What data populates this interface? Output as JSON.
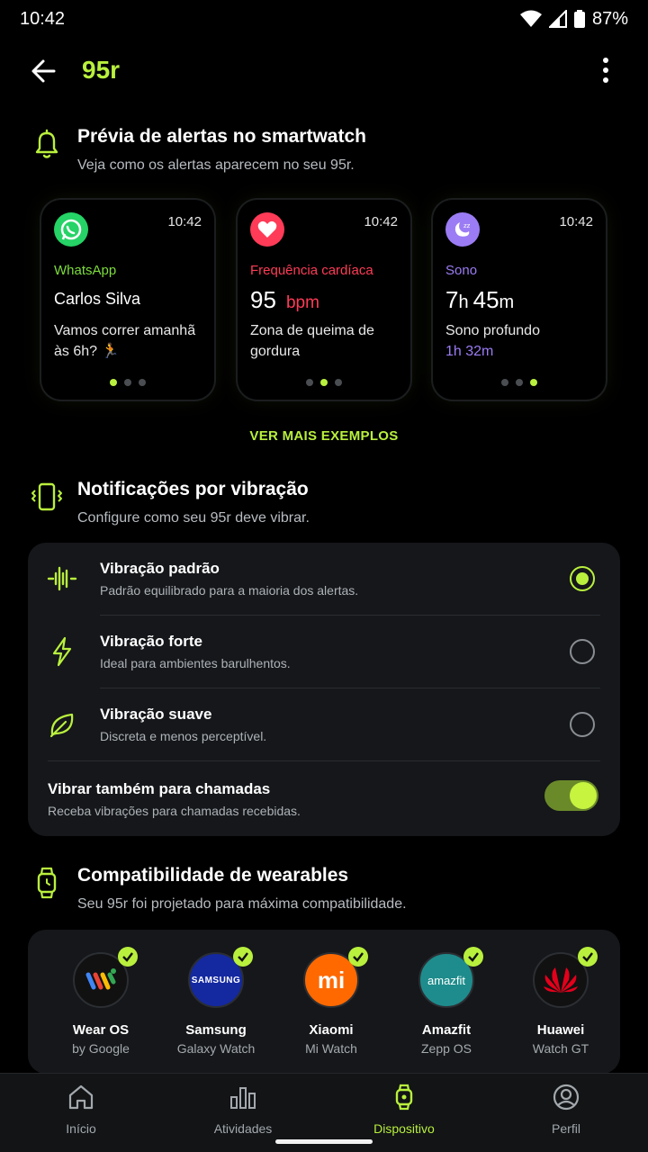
{
  "status": {
    "time": "10:42",
    "battery": "87%"
  },
  "appbar": {
    "title": "95r"
  },
  "preview": {
    "title": "Prévia de alertas no smartwatch",
    "subtitle": "Veja como os alertas aparecem no seu 95r.",
    "watches": [
      {
        "time": "10:42",
        "app": "WhatsApp",
        "main": "Carlos Silva",
        "body": "Vamos correr amanhã às 6h? 🏃",
        "accent": "#7ddc3c"
      },
      {
        "time": "10:42",
        "app": "Frequência cardíaca",
        "main_value": "95",
        "main_unit": "bpm",
        "body": "Zona de queima de gordura",
        "accent": "#ff3b57"
      },
      {
        "time": "10:42",
        "app": "Sono",
        "main_h": "7",
        "main_h_unit": "h",
        "main_m": "45",
        "main_m_unit": "m",
        "body": "Sono profundo",
        "body_highlight": "1h 32m",
        "accent": "#9b7cf4"
      }
    ],
    "see_more": "VER MAIS EXEMPLOS"
  },
  "vibration": {
    "title": "Notificações por vibração",
    "subtitle": "Configure como seu 95r deve vibrar.",
    "options": [
      {
        "title": "Vibração padrão",
        "subtitle": "Padrão equilibrado para a maioria dos alertas.",
        "selected": true,
        "icon": "waveform-icon"
      },
      {
        "title": "Vibração forte",
        "subtitle": "Ideal para ambientes barulhentos.",
        "selected": false,
        "icon": "lightning-icon"
      },
      {
        "title": "Vibração suave",
        "subtitle": "Discreta e menos perceptível.",
        "selected": false,
        "icon": "leaf-icon"
      }
    ],
    "calls": {
      "title": "Vibrar também para chamadas",
      "subtitle": "Receba vibrações para chamadas recebidas.",
      "enabled": true
    }
  },
  "compat": {
    "title": "Compatibilidade de wearables",
    "subtitle": "Seu 95r foi projetado para máxima compatibilidade.",
    "brands": [
      {
        "name": "Wear OS",
        "sub": "by Google"
      },
      {
        "name": "Samsung",
        "sub": "Galaxy Watch",
        "logo_text": "SAMSUNG"
      },
      {
        "name": "Xiaomi",
        "sub": "Mi Watch",
        "logo_text": "mi"
      },
      {
        "name": "Amazfit",
        "sub": "Zepp OS",
        "logo_text": "amazfit"
      },
      {
        "name": "Huawei",
        "sub": "Watch GT"
      }
    ]
  },
  "nav": {
    "items": [
      {
        "label": "Início",
        "icon": "home-icon",
        "active": false
      },
      {
        "label": "Atividades",
        "icon": "bar-chart-icon",
        "active": false
      },
      {
        "label": "Dispositivo",
        "icon": "watch-icon",
        "active": true
      },
      {
        "label": "Perfil",
        "icon": "profile-icon",
        "active": false
      }
    ]
  },
  "colors": {
    "accent": "#b9f03d",
    "background": "#000000",
    "card": "#15171a"
  }
}
